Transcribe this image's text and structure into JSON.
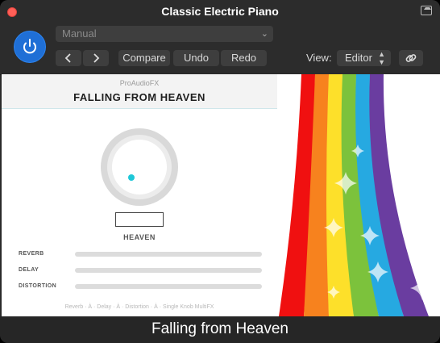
{
  "window": {
    "title": "Classic Electric Piano",
    "caption": "Falling from Heaven"
  },
  "header": {
    "preset_value": "Manual",
    "back_icon": "chevron-left-icon",
    "forward_icon": "chevron-right-icon",
    "compare_label": "Compare",
    "undo_label": "Undo",
    "redo_label": "Redo",
    "view_label": "View:",
    "view_value": "Editor",
    "link_icon": "link-icon",
    "power_icon": "power-icon"
  },
  "plugin": {
    "brand": "ProAudioFX",
    "name": "FALLING FROM HEAVEN",
    "knob_label": "HEAVEN",
    "knob_value": "",
    "params": [
      {
        "label": "REVERB",
        "value": 0
      },
      {
        "label": "DELAY",
        "value": 0
      },
      {
        "label": "DISTORTION",
        "value": 0
      }
    ],
    "footer": "Reverb · À · Delay · À · Distortion · À · Single Knob MultiFX"
  },
  "colors": {
    "power": "#1f6fd6",
    "knob_dot": "#1ec8d8",
    "rainbow": [
      "#f01010",
      "#f7821e",
      "#fde02a",
      "#7cc23c",
      "#26a9e1",
      "#6a3da0"
    ]
  }
}
